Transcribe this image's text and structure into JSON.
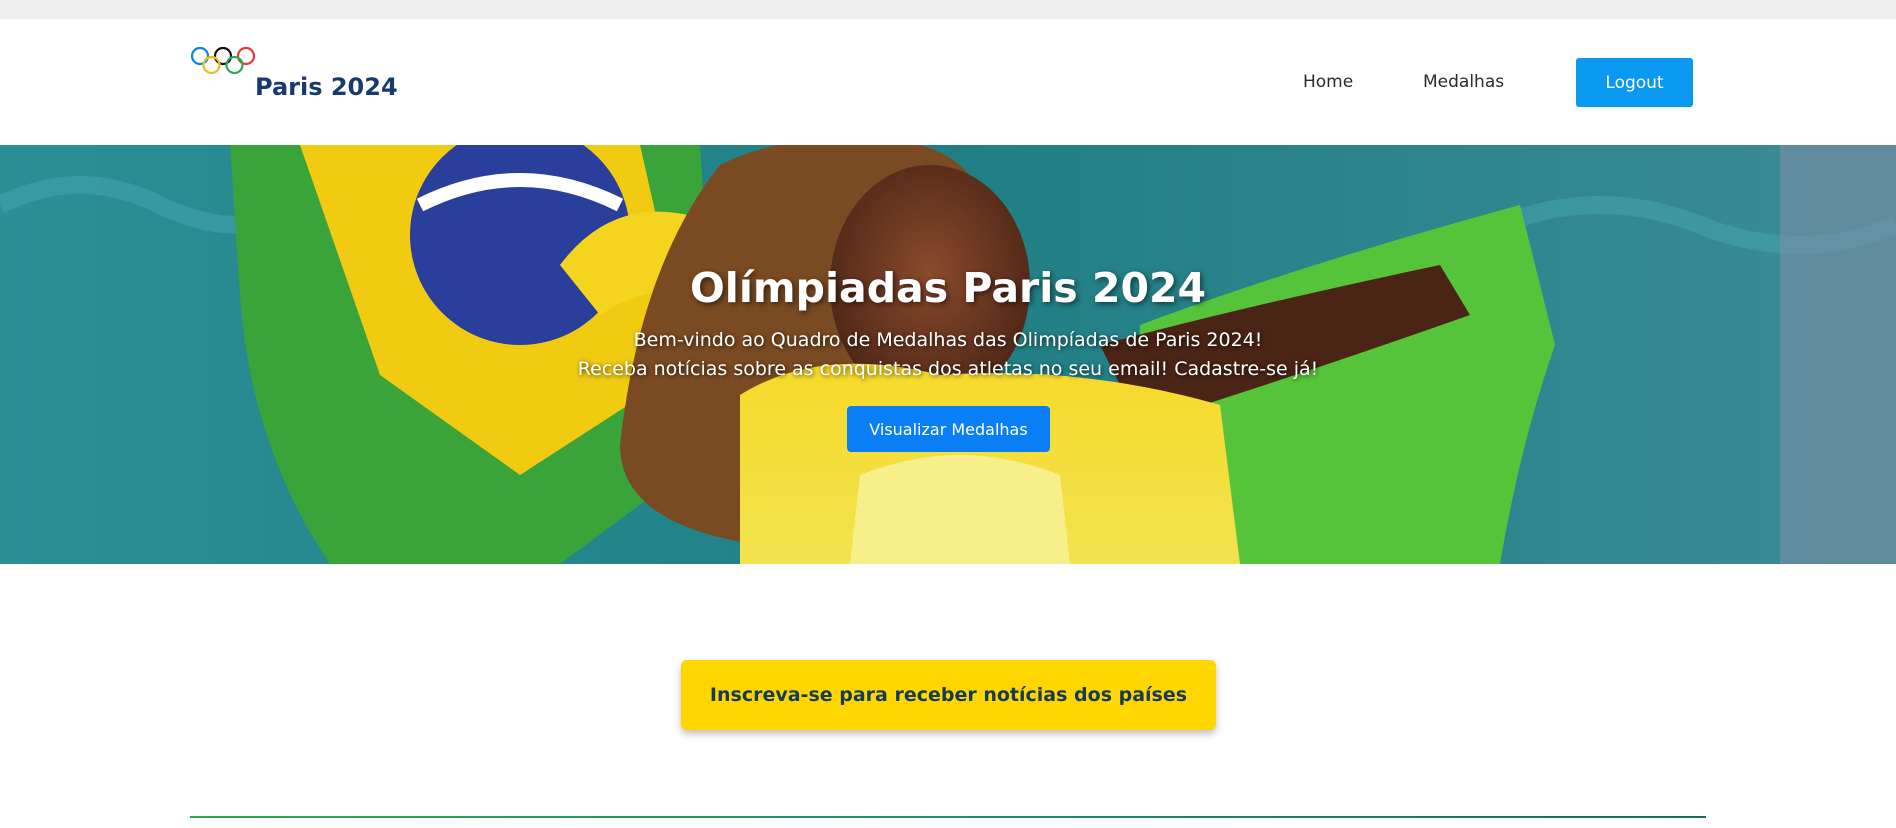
{
  "header": {
    "brand": "Paris 2024",
    "logo_icon": "olympic-rings-icon",
    "nav": [
      {
        "label": "Home"
      },
      {
        "label": "Medalhas"
      }
    ],
    "logout_label": "Logout",
    "colors": {
      "brand": "#173b6c",
      "logout": "#0a98f0"
    }
  },
  "hero": {
    "title": "Olímpiadas Paris 2024",
    "subtitle_line1": "Bem-vindo ao Quadro de Medalhas das Olimpíadas de Paris 2024!",
    "subtitle_line2": "Receba notícias sobre as conquistas dos atletas no seu email! Cadastre-se já!",
    "button_label": "Visualizar Medalhas",
    "colors": {
      "button": "#0a7ff5"
    }
  },
  "subscribe": {
    "label": "Inscreva-se para receber notícias dos países",
    "color": "#ffd600"
  }
}
